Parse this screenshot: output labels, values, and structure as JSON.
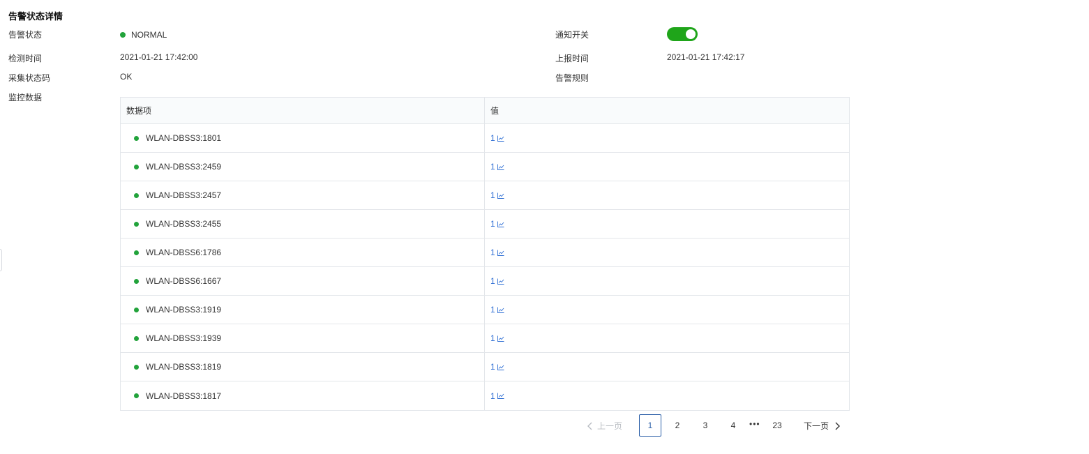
{
  "header": {
    "title": "告警状态详情"
  },
  "details": {
    "alert_status_label": "告警状态",
    "alert_status_value": "NORMAL",
    "notify_switch_label": "通知开关",
    "detect_time_label": "检测时间",
    "detect_time_value": "2021-01-21 17:42:00",
    "report_time_label": "上报时间",
    "report_time_value": "2021-01-21 17:42:17",
    "collect_code_label": "采集状态码",
    "collect_code_value": "OK",
    "alert_rule_label": "告警规则",
    "monitor_data_label": "监控数据"
  },
  "colors": {
    "ok_green": "#22a33b",
    "toggle_on": "#1fa51a",
    "link_blue": "#2b6cd3"
  },
  "table": {
    "headers": [
      "数据项",
      "值"
    ],
    "rows": [
      {
        "item": "WLAN-DBSS3:1801",
        "value": "1"
      },
      {
        "item": "WLAN-DBSS3:2459",
        "value": "1"
      },
      {
        "item": "WLAN-DBSS3:2457",
        "value": "1"
      },
      {
        "item": "WLAN-DBSS3:2455",
        "value": "1"
      },
      {
        "item": "WLAN-DBSS6:1786",
        "value": "1"
      },
      {
        "item": "WLAN-DBSS6:1667",
        "value": "1"
      },
      {
        "item": "WLAN-DBSS3:1919",
        "value": "1"
      },
      {
        "item": "WLAN-DBSS3:1939",
        "value": "1"
      },
      {
        "item": "WLAN-DBSS3:1819",
        "value": "1"
      },
      {
        "item": "WLAN-DBSS3:1817",
        "value": "1"
      }
    ]
  },
  "pagination": {
    "prev_label": "上一页",
    "next_label": "下一页",
    "pages": [
      "1",
      "2",
      "3",
      "4"
    ],
    "ellipsis": "•••",
    "last_page": "23",
    "current": "1"
  }
}
